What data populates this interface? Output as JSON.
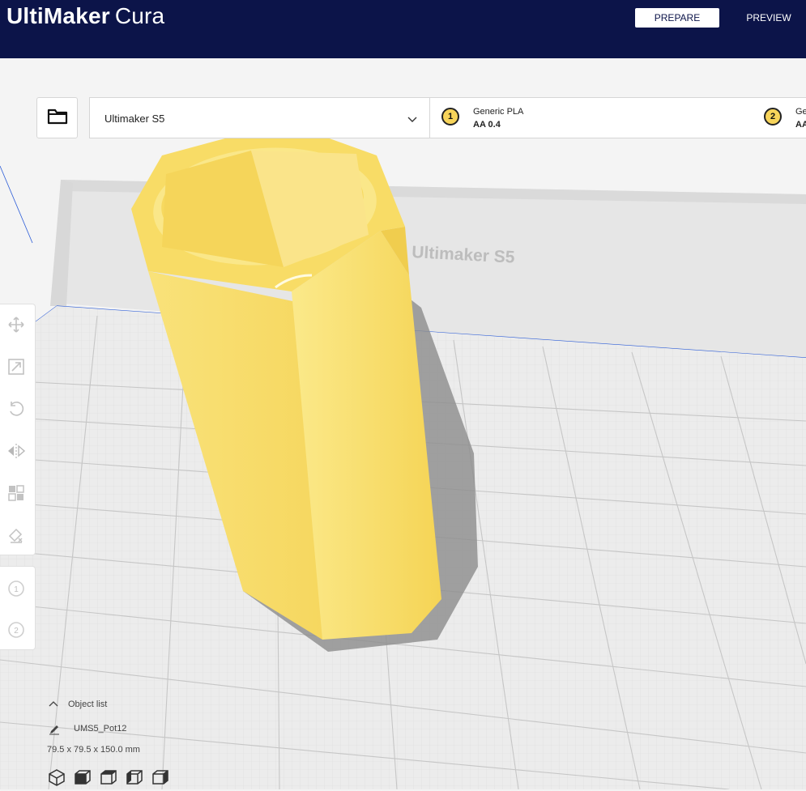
{
  "app": {
    "brand": "UltiMaker",
    "product": "Cura"
  },
  "header": {
    "tabs": [
      {
        "label": "PREPARE",
        "active": true
      },
      {
        "label": "PREVIEW",
        "active": false
      }
    ]
  },
  "toolbar": {
    "open_icon": "folder-icon",
    "machine": "Ultimaker S5",
    "extruders": [
      {
        "index": "1",
        "material": "Generic PLA",
        "nozzle": "AA 0.4"
      },
      {
        "index": "2",
        "material": "Ge",
        "nozzle": "AA"
      }
    ]
  },
  "viewport": {
    "build_plate_label": "Ultimaker S5"
  },
  "left_tools": [
    {
      "name": "move-icon"
    },
    {
      "name": "scale-icon"
    },
    {
      "name": "rotate-icon"
    },
    {
      "name": "mirror-icon"
    },
    {
      "name": "per-model-settings-icon"
    },
    {
      "name": "support-blocker-icon"
    }
  ],
  "extruder_tools": [
    {
      "label": "1"
    },
    {
      "label": "2"
    }
  ],
  "object_list": {
    "label": "Object list",
    "object_name": "UMS5_Pot12",
    "dimensions": "79.5 x 79.5 x 150.0 mm"
  },
  "view_buttons": [
    {
      "name": "3d-view-icon"
    },
    {
      "name": "front-view-icon"
    },
    {
      "name": "top-view-icon"
    },
    {
      "name": "left-view-icon"
    },
    {
      "name": "right-view-icon"
    }
  ],
  "colors": {
    "header_bg": "#0c1449",
    "model_yellow": "#f7dc6f",
    "extruder_badge": "#f7d45a",
    "bed_grid": "#c8c8c8"
  }
}
